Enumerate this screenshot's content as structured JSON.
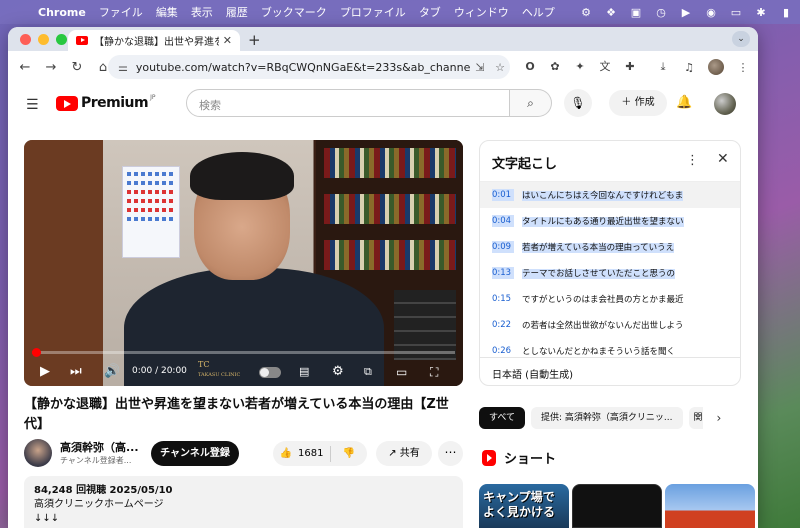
{
  "menubar": {
    "apple": "",
    "app": "Chrome",
    "items": [
      "ファイル",
      "編集",
      "表示",
      "履歴",
      "ブックマーク",
      "プロファイル",
      "タブ",
      "ウィンドウ",
      "ヘルプ"
    ]
  },
  "tab": {
    "title": "【静かな退職】出世や昇進を望ま",
    "close": "✕"
  },
  "toolbar": {
    "url": "youtube.com/watch?v=RBqCWQnNGaE&t=233s&ab_channel=高須幹..."
  },
  "masthead": {
    "logo_text": "Premium",
    "logo_region": "JP",
    "search_placeholder": "検索",
    "create_label": "作成"
  },
  "player": {
    "time": "0:00 / 20:00",
    "progress_fraction": 0.01,
    "overlay_text": "TC",
    "overlay_sub": "TAKASU CLINIC"
  },
  "video": {
    "title": "【静かな退職】出世や昇進を望まない若者が増えている本当の理由【Z世代】",
    "channel_name": "高須幹弥（高...",
    "channel_subs": "チャンネル登録者...",
    "subscribe_label": "チャンネル登録",
    "like_count": "1681",
    "share_label": "共有",
    "description": {
      "stats": "84,248 回視聴  2025/05/10",
      "line1": "高須クリニックホームページ",
      "line2": "↓↓↓"
    }
  },
  "transcript": {
    "title": "文字起こし",
    "language": "日本語 (自動生成)",
    "segments": [
      {
        "time": "0:01",
        "text": "はいこんにちはえ今回なんですけれどもま"
      },
      {
        "time": "0:04",
        "text": "タイトルにもある通り最近出世を望まない"
      },
      {
        "time": "0:09",
        "text": "若者が増えている本当の理由っていうえ"
      },
      {
        "time": "0:13",
        "text": "テーマでお話しさせていただこと思うの"
      },
      {
        "time": "0:15",
        "text": "ですがというのはま会社員の方とかま最近"
      },
      {
        "time": "0:22",
        "text": "の若者は全然出世欲がないんだ出世しよう"
      },
      {
        "time": "0:26",
        "text": "としないんだとかねまそういう話を聞く"
      }
    ]
  },
  "chips": {
    "all": "すべて",
    "provided": "提供: 高須幹弥（高須クリニッ...",
    "truncated": "関"
  },
  "shorts": {
    "label": "ショート",
    "thumb1_text": "キャンプ場で\nよく見かける"
  },
  "colors": {
    "youtube_red": "#ff0000",
    "transcript_highlight": "#cfe0fc"
  }
}
